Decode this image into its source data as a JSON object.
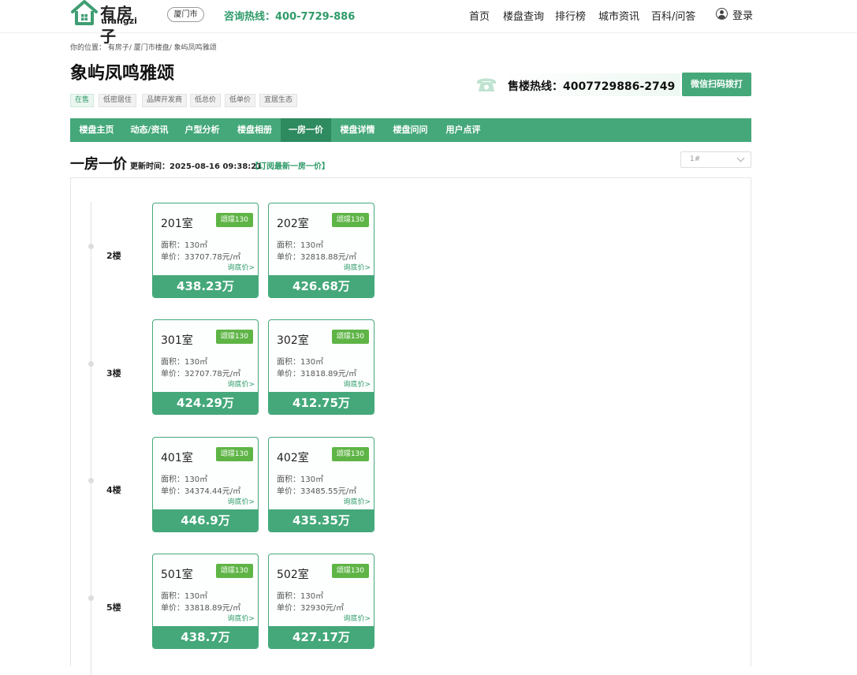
{
  "header": {
    "logo_cn": "有房子",
    "logo_en": "ufangzi",
    "city": "厦门市",
    "hotline": "咨询热线：400-7729-886",
    "nav": [
      "首页",
      "楼盘查询",
      "排行榜",
      "城市资讯",
      "百科/问答"
    ],
    "login": "登录"
  },
  "breadcrumb": "你的位置：  有房子/ 厦门市楼盘/ 象屿凤鸣雅颂",
  "property": {
    "name": "象屿凤鸣雅颂",
    "tags": [
      "在售",
      "低密居住",
      "品牌开发商",
      "低总价",
      "低单价",
      "宜居生态"
    ],
    "sales_hotline": "售楼热线：4007729886-2749",
    "wechat_button": "微信扫码拨打"
  },
  "tabs": [
    "楼盘主页",
    "动态/资讯",
    "户型分析",
    "楼盘相册",
    "一房一价",
    "楼盘详情",
    "楼盘问问",
    "用户点评"
  ],
  "active_tab": "一房一价",
  "section": {
    "title": "一房一价",
    "updated": "更新时间：2025-08-16 09:38:21",
    "subscribe": "【订阅最新一房一价】",
    "building_select": "1#"
  },
  "colors": {
    "brand": "#45a87a",
    "brand_dark": "#2e8a5f",
    "badge": "#5fb446"
  },
  "floors": [
    {
      "label": "2楼",
      "rooms": [
        {
          "room": "201室",
          "badge": "颂璟130",
          "area": "面积：130㎡",
          "unit": "单价：33707.78元/㎡",
          "ask": "询底价>",
          "price": "438.23万"
        },
        {
          "room": "202室",
          "badge": "颂璟130",
          "area": "面积：130㎡",
          "unit": "单价：32818.88元/㎡",
          "ask": "询底价>",
          "price": "426.68万"
        }
      ]
    },
    {
      "label": "3楼",
      "rooms": [
        {
          "room": "301室",
          "badge": "颂璟130",
          "area": "面积：130㎡",
          "unit": "单价：32707.78元/㎡",
          "ask": "询底价>",
          "price": "424.29万"
        },
        {
          "room": "302室",
          "badge": "颂璟130",
          "area": "面积：130㎡",
          "unit": "单价：31818.89元/㎡",
          "ask": "询底价>",
          "price": "412.75万"
        }
      ]
    },
    {
      "label": "4楼",
      "rooms": [
        {
          "room": "401室",
          "badge": "颂璟130",
          "area": "面积：130㎡",
          "unit": "单价：34374.44元/㎡",
          "ask": "询底价>",
          "price": "446.9万"
        },
        {
          "room": "402室",
          "badge": "颂璟130",
          "area": "面积：130㎡",
          "unit": "单价：33485.55元/㎡",
          "ask": "询底价>",
          "price": "435.35万"
        }
      ]
    },
    {
      "label": "5楼",
      "rooms": [
        {
          "room": "501室",
          "badge": "颂璟130",
          "area": "面积：130㎡",
          "unit": "单价：33818.89元/㎡",
          "ask": "询底价>",
          "price": "438.7万"
        },
        {
          "room": "502室",
          "badge": "颂璟130",
          "area": "面积：130㎡",
          "unit": "单价：32930元/㎡",
          "ask": "询底价>",
          "price": "427.17万"
        }
      ]
    }
  ]
}
